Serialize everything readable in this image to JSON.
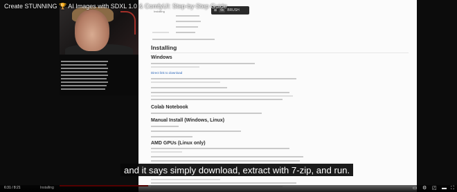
{
  "video": {
    "title": "Create STUNNING 🏆 AI Images with SDXL 1.0 & ComfyUI: Step-by-Step Guide",
    "subtitle": "and it says simply download, extract with 7-zip, and run.",
    "progress_fraction": 0.25
  },
  "toolbar": {
    "left_label": "⊠",
    "shortcut": "fw",
    "right_label": "BRUSH"
  },
  "document": {
    "headings": [
      "Installing",
      "Windows",
      "Colab Notebook",
      "Manual Install (Windows, Linux)",
      "AMD GPUs (Linux only)"
    ],
    "link": "Direct link to download"
  },
  "controls": {
    "time_left": "6:31 / 8:21",
    "chapter": "Installing",
    "icon_names": [
      "play-icon",
      "next-icon",
      "volume-icon",
      "cc-icon",
      "settings-icon",
      "miniplayer-icon",
      "theater-icon",
      "fullscreen-icon"
    ],
    "accent": "#e00000"
  }
}
